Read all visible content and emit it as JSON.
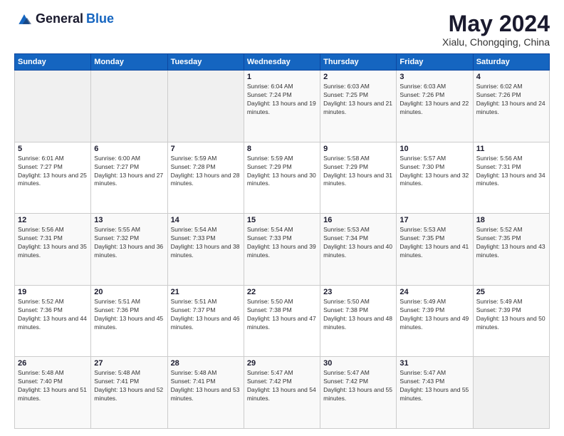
{
  "logo": {
    "general": "General",
    "blue": "Blue"
  },
  "header": {
    "month_year": "May 2024",
    "location": "Xialu, Chongqing, China"
  },
  "weekdays": [
    "Sunday",
    "Monday",
    "Tuesday",
    "Wednesday",
    "Thursday",
    "Friday",
    "Saturday"
  ],
  "weeks": [
    [
      {
        "day": "",
        "sunrise": "",
        "sunset": "",
        "daylight": ""
      },
      {
        "day": "",
        "sunrise": "",
        "sunset": "",
        "daylight": ""
      },
      {
        "day": "",
        "sunrise": "",
        "sunset": "",
        "daylight": ""
      },
      {
        "day": "1",
        "sunrise": "Sunrise: 6:04 AM",
        "sunset": "Sunset: 7:24 PM",
        "daylight": "Daylight: 13 hours and 19 minutes."
      },
      {
        "day": "2",
        "sunrise": "Sunrise: 6:03 AM",
        "sunset": "Sunset: 7:25 PM",
        "daylight": "Daylight: 13 hours and 21 minutes."
      },
      {
        "day": "3",
        "sunrise": "Sunrise: 6:03 AM",
        "sunset": "Sunset: 7:26 PM",
        "daylight": "Daylight: 13 hours and 22 minutes."
      },
      {
        "day": "4",
        "sunrise": "Sunrise: 6:02 AM",
        "sunset": "Sunset: 7:26 PM",
        "daylight": "Daylight: 13 hours and 24 minutes."
      }
    ],
    [
      {
        "day": "5",
        "sunrise": "Sunrise: 6:01 AM",
        "sunset": "Sunset: 7:27 PM",
        "daylight": "Daylight: 13 hours and 25 minutes."
      },
      {
        "day": "6",
        "sunrise": "Sunrise: 6:00 AM",
        "sunset": "Sunset: 7:27 PM",
        "daylight": "Daylight: 13 hours and 27 minutes."
      },
      {
        "day": "7",
        "sunrise": "Sunrise: 5:59 AM",
        "sunset": "Sunset: 7:28 PM",
        "daylight": "Daylight: 13 hours and 28 minutes."
      },
      {
        "day": "8",
        "sunrise": "Sunrise: 5:59 AM",
        "sunset": "Sunset: 7:29 PM",
        "daylight": "Daylight: 13 hours and 30 minutes."
      },
      {
        "day": "9",
        "sunrise": "Sunrise: 5:58 AM",
        "sunset": "Sunset: 7:29 PM",
        "daylight": "Daylight: 13 hours and 31 minutes."
      },
      {
        "day": "10",
        "sunrise": "Sunrise: 5:57 AM",
        "sunset": "Sunset: 7:30 PM",
        "daylight": "Daylight: 13 hours and 32 minutes."
      },
      {
        "day": "11",
        "sunrise": "Sunrise: 5:56 AM",
        "sunset": "Sunset: 7:31 PM",
        "daylight": "Daylight: 13 hours and 34 minutes."
      }
    ],
    [
      {
        "day": "12",
        "sunrise": "Sunrise: 5:56 AM",
        "sunset": "Sunset: 7:31 PM",
        "daylight": "Daylight: 13 hours and 35 minutes."
      },
      {
        "day": "13",
        "sunrise": "Sunrise: 5:55 AM",
        "sunset": "Sunset: 7:32 PM",
        "daylight": "Daylight: 13 hours and 36 minutes."
      },
      {
        "day": "14",
        "sunrise": "Sunrise: 5:54 AM",
        "sunset": "Sunset: 7:33 PM",
        "daylight": "Daylight: 13 hours and 38 minutes."
      },
      {
        "day": "15",
        "sunrise": "Sunrise: 5:54 AM",
        "sunset": "Sunset: 7:33 PM",
        "daylight": "Daylight: 13 hours and 39 minutes."
      },
      {
        "day": "16",
        "sunrise": "Sunrise: 5:53 AM",
        "sunset": "Sunset: 7:34 PM",
        "daylight": "Daylight: 13 hours and 40 minutes."
      },
      {
        "day": "17",
        "sunrise": "Sunrise: 5:53 AM",
        "sunset": "Sunset: 7:35 PM",
        "daylight": "Daylight: 13 hours and 41 minutes."
      },
      {
        "day": "18",
        "sunrise": "Sunrise: 5:52 AM",
        "sunset": "Sunset: 7:35 PM",
        "daylight": "Daylight: 13 hours and 43 minutes."
      }
    ],
    [
      {
        "day": "19",
        "sunrise": "Sunrise: 5:52 AM",
        "sunset": "Sunset: 7:36 PM",
        "daylight": "Daylight: 13 hours and 44 minutes."
      },
      {
        "day": "20",
        "sunrise": "Sunrise: 5:51 AM",
        "sunset": "Sunset: 7:36 PM",
        "daylight": "Daylight: 13 hours and 45 minutes."
      },
      {
        "day": "21",
        "sunrise": "Sunrise: 5:51 AM",
        "sunset": "Sunset: 7:37 PM",
        "daylight": "Daylight: 13 hours and 46 minutes."
      },
      {
        "day": "22",
        "sunrise": "Sunrise: 5:50 AM",
        "sunset": "Sunset: 7:38 PM",
        "daylight": "Daylight: 13 hours and 47 minutes."
      },
      {
        "day": "23",
        "sunrise": "Sunrise: 5:50 AM",
        "sunset": "Sunset: 7:38 PM",
        "daylight": "Daylight: 13 hours and 48 minutes."
      },
      {
        "day": "24",
        "sunrise": "Sunrise: 5:49 AM",
        "sunset": "Sunset: 7:39 PM",
        "daylight": "Daylight: 13 hours and 49 minutes."
      },
      {
        "day": "25",
        "sunrise": "Sunrise: 5:49 AM",
        "sunset": "Sunset: 7:39 PM",
        "daylight": "Daylight: 13 hours and 50 minutes."
      }
    ],
    [
      {
        "day": "26",
        "sunrise": "Sunrise: 5:48 AM",
        "sunset": "Sunset: 7:40 PM",
        "daylight": "Daylight: 13 hours and 51 minutes."
      },
      {
        "day": "27",
        "sunrise": "Sunrise: 5:48 AM",
        "sunset": "Sunset: 7:41 PM",
        "daylight": "Daylight: 13 hours and 52 minutes."
      },
      {
        "day": "28",
        "sunrise": "Sunrise: 5:48 AM",
        "sunset": "Sunset: 7:41 PM",
        "daylight": "Daylight: 13 hours and 53 minutes."
      },
      {
        "day": "29",
        "sunrise": "Sunrise: 5:47 AM",
        "sunset": "Sunset: 7:42 PM",
        "daylight": "Daylight: 13 hours and 54 minutes."
      },
      {
        "day": "30",
        "sunrise": "Sunrise: 5:47 AM",
        "sunset": "Sunset: 7:42 PM",
        "daylight": "Daylight: 13 hours and 55 minutes."
      },
      {
        "day": "31",
        "sunrise": "Sunrise: 5:47 AM",
        "sunset": "Sunset: 7:43 PM",
        "daylight": "Daylight: 13 hours and 55 minutes."
      },
      {
        "day": "",
        "sunrise": "",
        "sunset": "",
        "daylight": ""
      }
    ]
  ]
}
